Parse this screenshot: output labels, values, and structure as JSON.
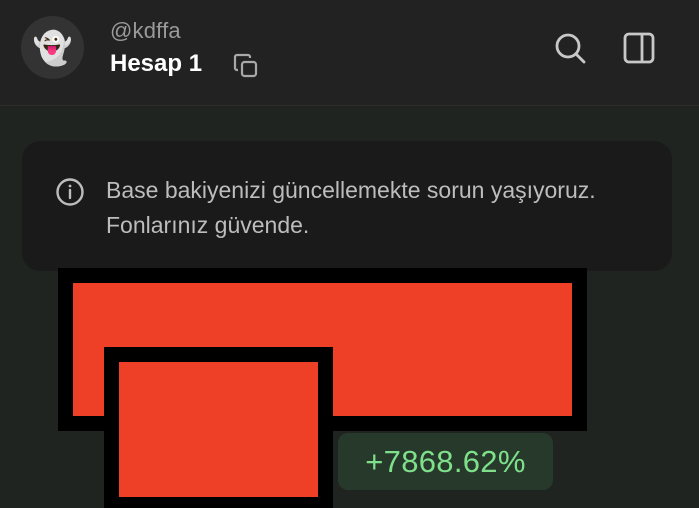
{
  "header": {
    "avatar_emoji": "👻",
    "username": "@kdffa",
    "account_name": "Hesap 1",
    "icons": {
      "copy": "copy-icon",
      "search": "search-icon",
      "sidebar": "sidebar-toggle-icon"
    }
  },
  "notice": {
    "icon": "info-icon",
    "text": "Base bakiyenizi güncellemekte sorun yaşıyoruz. Fonlarınız güvende."
  },
  "balance": {
    "change_percent": "+7868.62%"
  },
  "colors": {
    "header_bg": "#222222",
    "page_bg": "#1f2420",
    "notice_bg": "#1a1a1a",
    "redaction_fill": "#ee4027",
    "positive_text": "#7ee08a",
    "positive_bg": "#26392b"
  }
}
